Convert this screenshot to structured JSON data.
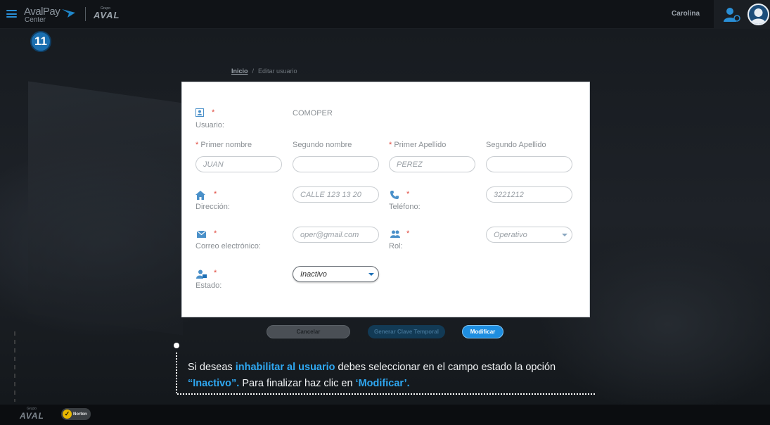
{
  "header": {
    "brand_top": "AvalPay",
    "brand_bottom": "Center",
    "group_small": "Grupo",
    "group_logo": "AVAL",
    "user_name": "Carolina"
  },
  "step_badge": "11",
  "breadcrumb": {
    "home": "Inicio",
    "separator": "/",
    "current": "Editar usuario"
  },
  "form": {
    "usuario": {
      "label": "Usuario:",
      "value": "COMOPER"
    },
    "primer_nombre": {
      "label": "Primer nombre",
      "value": "JUAN"
    },
    "segundo_nombre": {
      "label": "Segundo nombre",
      "value": ""
    },
    "primer_apellido": {
      "label": "Primer Apellido",
      "value": "PEREZ"
    },
    "segundo_apellido": {
      "label": "Segundo Apellido",
      "value": ""
    },
    "direccion": {
      "label": "Dirección:",
      "value": "CALLE 123 13 20"
    },
    "telefono": {
      "label": "Teléfono:",
      "value": "3221212"
    },
    "correo": {
      "label": "Correo electrónico:",
      "value": "oper@gmail.com"
    },
    "rol": {
      "label": "Rol:",
      "value": "Operativo"
    },
    "estado": {
      "label": "Estado:",
      "value": "Inactivo"
    },
    "required_mark": "*"
  },
  "buttons": {
    "cancel": "Cancelar",
    "temp_key": "Generar Clave Temporal",
    "modify": "Modificar"
  },
  "instruction": {
    "part1": "Si deseas ",
    "highlight1": "inhabilitar al usuario",
    "part2": " debes seleccionar en el campo estado la opción ",
    "highlight2": "“Inactivo”.",
    "part3": " Para finalizar haz clic en ",
    "highlight3": "‘Modificar’."
  },
  "footer": {
    "group_small": "Grupo",
    "group_logo": "AVAL",
    "norton": "Norton"
  },
  "colors": {
    "accent": "#1e8ee0",
    "highlight": "#2fa8f2",
    "required": "#e0473c",
    "badge": "#1b6fb0"
  },
  "icons": {
    "menu": "hamburger-icon",
    "usuario": "id-card-icon",
    "direccion": "home-icon",
    "telefono": "phone-icon",
    "correo": "envelope-icon",
    "rol": "users-icon",
    "estado": "user-lock-icon",
    "user_settings": "user-settings-icon",
    "avatar": "avatar"
  }
}
